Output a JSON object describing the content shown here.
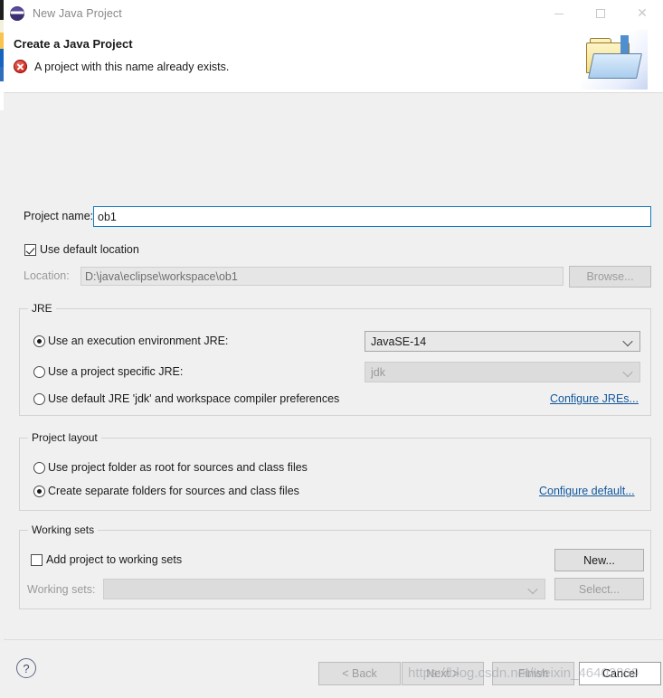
{
  "window": {
    "title": "New Java Project",
    "icon": "eclipse-icon",
    "controls": {
      "minimize": "minimize-icon",
      "maximize": "maximize-icon",
      "close": "close-icon"
    }
  },
  "header": {
    "title": "Create a Java Project",
    "message": "A project with this name already exists.",
    "message_icon": "error-icon",
    "wizard_icon": "folder-import-icon"
  },
  "form": {
    "project_name_label": "Project name:",
    "project_name_value": "ob1",
    "project_name_placeholder": "",
    "use_default_location_label": "Use default location",
    "use_default_location_checked": true,
    "location_label": "Location:",
    "location_value": "D:\\java\\eclipse\\workspace\\ob1",
    "browse_label": "Browse..."
  },
  "jre": {
    "group_title": "JRE",
    "option_execution_env": "Use an execution environment JRE:",
    "option_project_specific": "Use a project specific JRE:",
    "option_default_jre": "Use default JRE 'jdk' and workspace compiler preferences",
    "selected": "execution_env",
    "execution_env_value": "JavaSE-14",
    "project_specific_value": "jdk",
    "configure_link": "Configure JREs..."
  },
  "project_layout": {
    "group_title": "Project layout",
    "option_root": "Use project folder as root for sources and class files",
    "option_separate": "Create separate folders for sources and class files",
    "selected": "separate",
    "configure_link": "Configure default..."
  },
  "working_sets": {
    "group_title": "Working sets",
    "add_checkbox_label": "Add project to working sets",
    "add_checkbox_checked": false,
    "working_sets_label": "Working sets:",
    "working_sets_value": "",
    "new_label": "New...",
    "select_label": "Select..."
  },
  "footer": {
    "help_icon": "?",
    "back_label": "< Back",
    "next_label": "Next >",
    "finish_label": "Finish",
    "cancel_label": "Cancel"
  },
  "watermark": {
    "text": "https://blog.csdn.net/weixin_46402869"
  },
  "colors": {
    "dialog_bg": "#f0f0f0",
    "header_bg": "#ffffff",
    "focus_border": "#0f7bbd",
    "link": "#11579c",
    "error": "#d12b21"
  }
}
